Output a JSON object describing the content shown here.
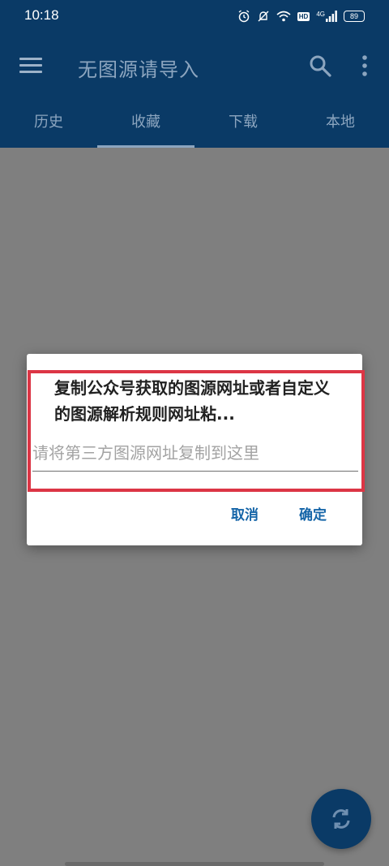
{
  "status_bar": {
    "time": "10:18",
    "battery": "89",
    "network_label": "4G",
    "hd_label": "HD",
    "icons": [
      "alarm-icon",
      "mute-icon",
      "wifi-icon",
      "hd-icon",
      "signal-icon",
      "battery-icon"
    ]
  },
  "app_bar": {
    "title": "无图源请导入",
    "icons": [
      "menu-icon",
      "search-icon",
      "overflow-menu-icon"
    ]
  },
  "tabs": [
    {
      "label": "历史",
      "active": false
    },
    {
      "label": "收藏",
      "active": true
    },
    {
      "label": "下载",
      "active": false
    },
    {
      "label": "本地",
      "active": false
    }
  ],
  "dialog": {
    "message": "复制公众号获取的图源网址或者自定义的图源解析规则网址粘...",
    "input_placeholder": "请将第三方图源网址复制到这里",
    "input_value": "",
    "cancel_label": "取消",
    "ok_label": "确定"
  },
  "colors": {
    "primary": "#0a3a66",
    "scrim": "#7f7f7f",
    "accent": "#1565a8",
    "highlight": "#dc3545"
  },
  "fab": {
    "icon": "sync-icon"
  }
}
